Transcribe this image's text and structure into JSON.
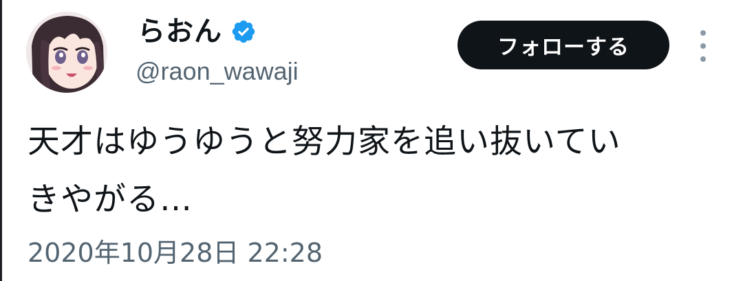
{
  "author": {
    "display_name": "らおん",
    "handle": "@raon_wawaji",
    "verified": true,
    "badge_color": "#1d9bf0",
    "avatar": "anime-girl-avatar"
  },
  "actions": {
    "follow_label": "フォローする",
    "more_icon": "more-vertical-icon"
  },
  "tweet": {
    "lines": [
      "天才はゆうゆうと努力家を追い抜いてい",
      "きやがる…"
    ],
    "timestamp": "2020年10月28日 22:28"
  },
  "colors": {
    "text_primary": "#0f1419",
    "text_secondary": "#536471",
    "button_bg": "#0f1419",
    "button_text": "#ffffff"
  }
}
